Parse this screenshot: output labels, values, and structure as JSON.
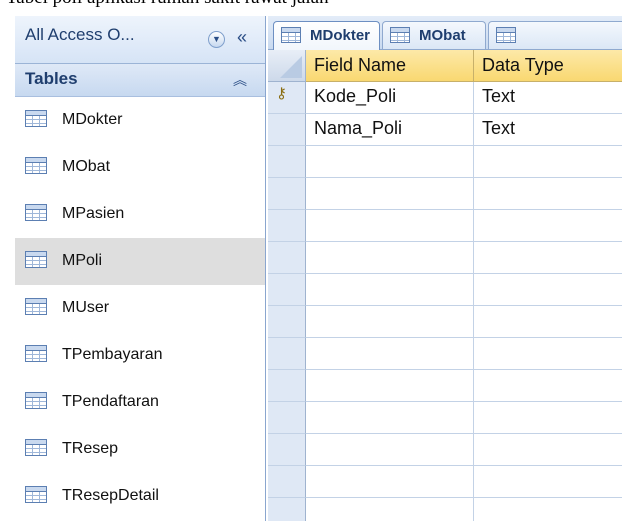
{
  "caption": "Tabel poli aplikasi rumah sakit rawat jalan",
  "nav": {
    "title": "All Access O...",
    "dropdown_icon": "circle-chevron-down-icon",
    "collapse_glyph": "«",
    "group": {
      "title": "Tables",
      "toggle_glyph": "︽"
    },
    "items": [
      {
        "label": "MDokter"
      },
      {
        "label": "MObat"
      },
      {
        "label": "MPasien"
      },
      {
        "label": "MPoli",
        "selected": true
      },
      {
        "label": "MUser"
      },
      {
        "label": "TPembayaran"
      },
      {
        "label": "TPendaftaran"
      },
      {
        "label": "TResep"
      },
      {
        "label": "TResepDetail"
      }
    ]
  },
  "tabs": [
    {
      "label": "MDokter",
      "active": true
    },
    {
      "label": "MObat",
      "active": false
    }
  ],
  "grid": {
    "headers": [
      "Field Name",
      "Data Type"
    ],
    "rows": [
      {
        "primary_key": true,
        "field": "Kode_Poli",
        "type": "Text"
      },
      {
        "primary_key": false,
        "field": "Nama_Poli",
        "type": "Text"
      }
    ],
    "key_icon": "key-icon"
  },
  "colors": {
    "header_gold": "#f9d871",
    "nav_blue": "#d6e4f6",
    "selection_gray": "#dedede"
  }
}
